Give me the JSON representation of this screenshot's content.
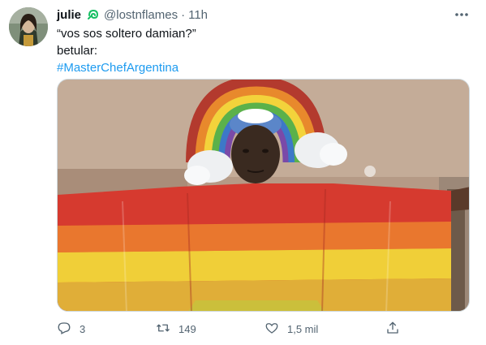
{
  "tweet": {
    "display_name": "julie",
    "handle": "@lostnflames",
    "separator": "·",
    "time": "11h",
    "text_lines": [
      "“vos sos soltero damian?”",
      "betular:"
    ],
    "hashtag": "#MasterChefArgentina",
    "media_description_icon": "photo",
    "actions": {
      "reply_count": "3",
      "retweet_count": "149",
      "like_count": "1,5 mil"
    }
  },
  "colors": {
    "accent": "#1d9bf0",
    "secondary_text": "#536471",
    "verified_badge": "#17bf63"
  },
  "icons": [
    "reply-icon",
    "retweet-icon",
    "like-icon",
    "share-icon",
    "more-icon",
    "badge-icon"
  ]
}
